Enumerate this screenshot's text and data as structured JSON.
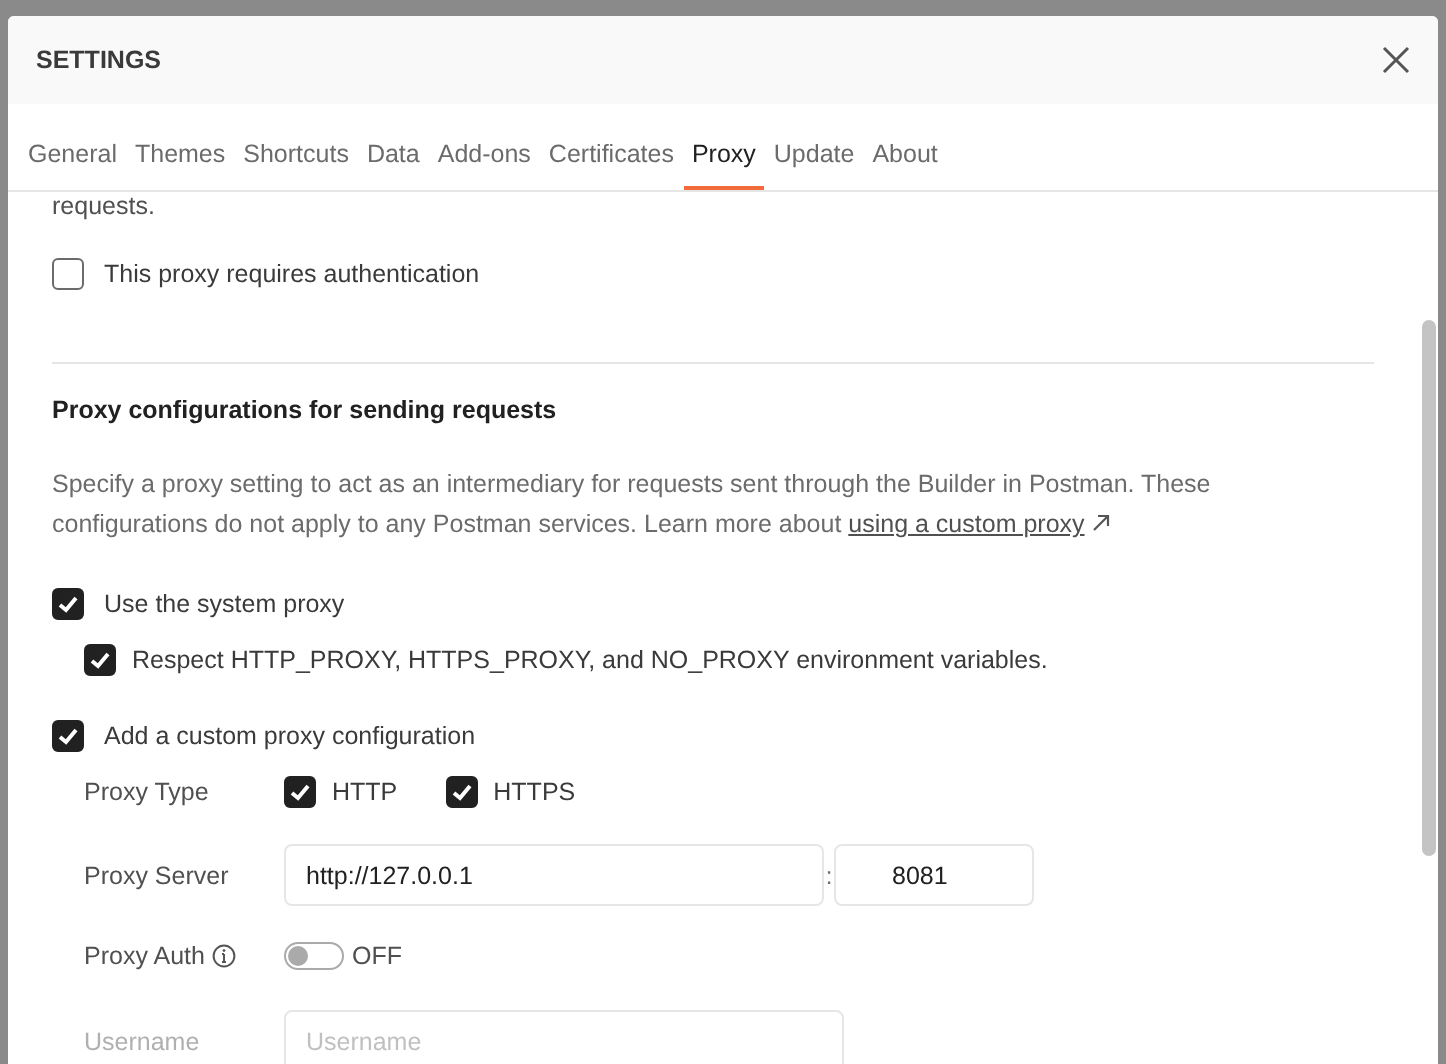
{
  "window": {
    "title": "SETTINGS"
  },
  "tabs": [
    {
      "label": "General",
      "selected": false
    },
    {
      "label": "Themes",
      "selected": false
    },
    {
      "label": "Shortcuts",
      "selected": false
    },
    {
      "label": "Data",
      "selected": false
    },
    {
      "label": "Add-ons",
      "selected": false
    },
    {
      "label": "Certificates",
      "selected": false
    },
    {
      "label": "Proxy",
      "selected": true
    },
    {
      "label": "Update",
      "selected": false
    },
    {
      "label": "About",
      "selected": false
    }
  ],
  "intro_tail": "requests.",
  "auth_checkbox": {
    "label": "This proxy requires authentication",
    "checked": false
  },
  "section": {
    "heading": "Proxy configurations for sending requests",
    "description": "Specify a proxy setting to act as an intermediary for requests sent through the Builder in Postman. These configurations do not apply to any Postman services. Learn more about",
    "link": "using a custom proxy"
  },
  "options": [
    {
      "label": "Use the system proxy",
      "checked": true,
      "children": [
        {
          "label": "Respect HTTP_PROXY, HTTPS_PROXY, and NO_PROXY environment variables.",
          "checked": true
        }
      ]
    },
    {
      "label": "Add a custom proxy configuration",
      "checked": true
    }
  ],
  "proxy_type": {
    "label": "Proxy Type",
    "options": [
      {
        "label": "HTTP",
        "checked": true
      },
      {
        "label": "HTTPS",
        "checked": true
      }
    ]
  },
  "proxy_server": {
    "label": "Proxy Server",
    "host": "http://127.0.0.1",
    "separator": ":",
    "port": "8081"
  },
  "proxy_auth": {
    "label": "Proxy Auth",
    "on": false,
    "state_text": "OFF"
  },
  "username": {
    "label": "Username",
    "placeholder": "Username",
    "disabled": true
  }
}
